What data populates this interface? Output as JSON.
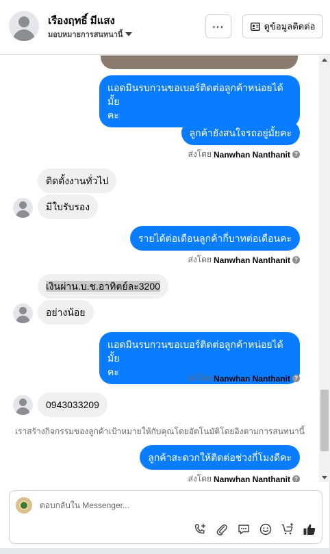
{
  "header": {
    "contact_name": "เรืองฤทธิ์ มีแสง",
    "assignment": "มอบหมายการสนทนานี้",
    "more_label": "···",
    "info_button_label": "ดูข้อมูลติดต่อ"
  },
  "messages": {
    "m1": "แอดมินรบกวนขอเบอร์ติดต่อลูกค้าหน่อยได้มั้ย",
    "m1_line2": "คะ",
    "m2": "ลูกค้ายังสนใจรถอยู่มั้ยคะ",
    "m3_in": "ติดตั้งงานทั่วไป",
    "m4_in": "มีใบรับรอง",
    "m5": "รายได้ต่อเดือนลูกค้ากี่บาทต่อเดือนคะ",
    "m6_in": "เงินผ่าน.บ.ช.อาทิตย์ละ3200",
    "m7_in": "อย่างน้อย",
    "m8": "แอดมินรบกวนขอเบอร์ติดต่อลูกค้าหน่อยได้มั้ย",
    "m8_line2": "คะ",
    "m9_in": "0943033209",
    "system_note": "เราสร้างกิจกรรมของลูกค้าเป้าหมายให้กับคุณโดยอัตโนมัติโดยอิงตามการสนทนานี้",
    "m10": "ลูกค้าสะดวกให้ติดต่อช่วงกี่โมงดีคะ"
  },
  "sent_by": {
    "prefix": "ส่งโดย",
    "agent": "Nanwhan Nanthanit",
    "help": "?"
  },
  "composer": {
    "placeholder": "ตอบกลับใน Messenger..."
  },
  "icons": {
    "composer_tools": [
      "phone-plus-icon",
      "paperclip-icon",
      "chat-bubble-icon",
      "emoji-icon",
      "cart-plus-icon",
      "thumbs-up-icon"
    ]
  },
  "colors": {
    "outgoing_bubble": "#0a7cff",
    "incoming_bubble": "#f0f0f0"
  }
}
